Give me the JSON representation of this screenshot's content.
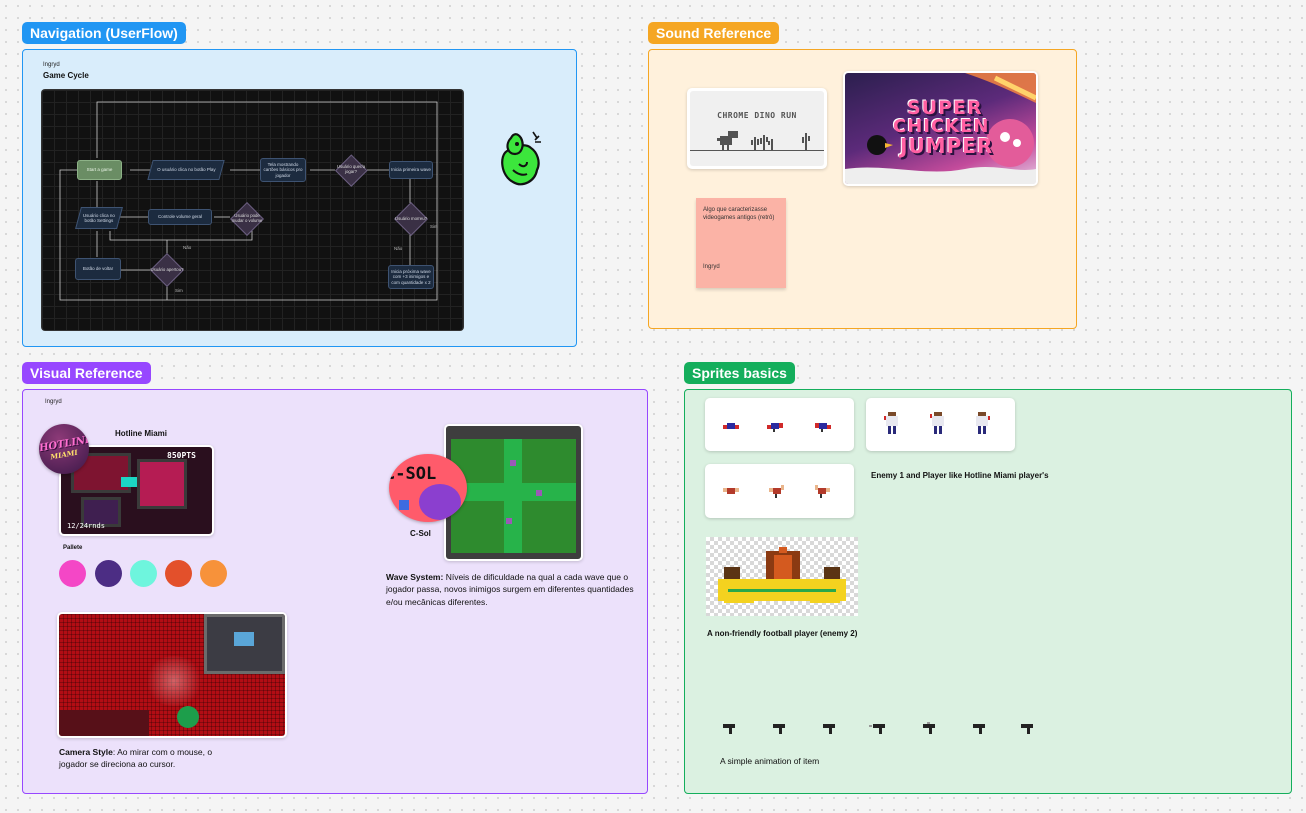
{
  "sections": {
    "navigation": {
      "label": "Navigation (UserFlow)",
      "color": "#2196f3"
    },
    "sound": {
      "label": "Sound Reference",
      "color": "#f5a623"
    },
    "visual": {
      "label": "Visual Reference",
      "color": "#9747ff"
    },
    "sprites": {
      "label": "Sprites basics",
      "color": "#14ae5c"
    }
  },
  "navigation": {
    "author": "Ingryd",
    "title": "Game Cycle",
    "flow": {
      "start": "Start a game",
      "play_click": "O usuário clica no botão Play",
      "tutorial_screen": "Tela mostrando cartões básicos pro jogador",
      "wants_play": "Usuário quer/a jogar?",
      "first_wave": "Inicia primeira wave",
      "settings_click": "Usuário clica no botão Settings",
      "volume_control": "Controle volume geral",
      "can_change_volume": "Usuário pode mudar o volume",
      "died": "Usuário morreu?",
      "back_button": "Botão de voltar",
      "pressed": "Usuário apertou?",
      "next_wave": "Inicia próxima wave com +3 inimigos e com quantidade x 2",
      "yes": "Sim",
      "no": "Não"
    }
  },
  "sound": {
    "dino_title": "CHROME DINO RUN",
    "chicken_title_1": "SUPER",
    "chicken_title_2": "CHICKEN",
    "chicken_title_3": "JUMPER",
    "sticky_text": "Algo que caracterizasse videogames antigos (retrô)",
    "sticky_author": "Ingryd"
  },
  "visual": {
    "author": "Ingryd",
    "hotline_label": "Hotline Miami",
    "hotline_logo_1": "HOTLINE",
    "hotline_logo_2": "MIAMI",
    "hotline_score": "850PTS",
    "hotline_ammo": "12/24rnds",
    "palette_label": "Pallete",
    "palette": [
      "#f447c6",
      "#4c2d84",
      "#6ef5dd",
      "#e3502b",
      "#f7923a"
    ],
    "csol_label": "C-Sol",
    "csol_logo": "C-SOL",
    "wave_title": "Wave System:",
    "wave_text": " Níveis de dificuldade na qual a cada wave que o jogador passa, novos inimigos surgem em diferentes quantidades e/ou mecânicas diferentes.",
    "camera_title": "Camera Style",
    "camera_text": ": Ao mirar com o mouse, o jogador se direciona ao cursor."
  },
  "sprites": {
    "enemy_caption": "Enemy 1 and Player like Hotline Miami player's",
    "football_caption": "A non-friendly football player (enemy 2)",
    "item_caption": "A simple animation of item"
  }
}
